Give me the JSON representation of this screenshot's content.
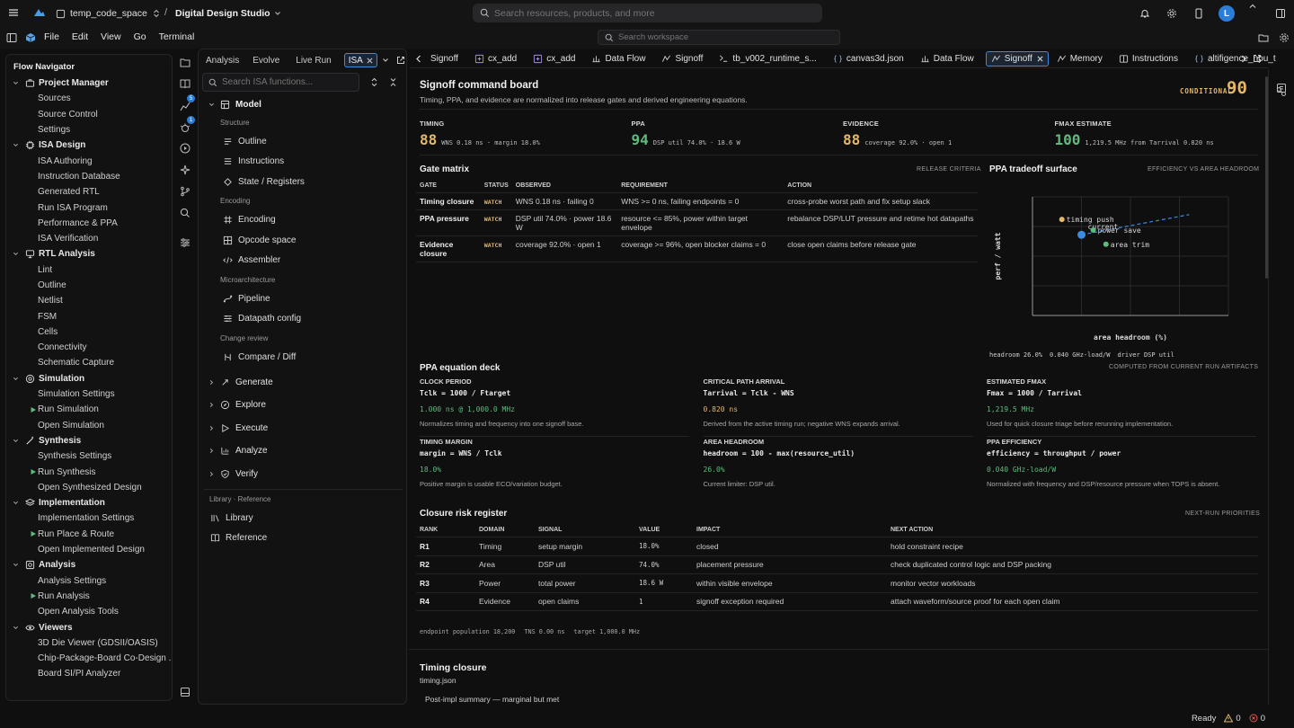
{
  "topbar": {
    "workspace": "temp_code_space",
    "separator": "/",
    "project": "Digital Design Studio",
    "search_placeholder": "Search resources, products, and more",
    "avatar_letter": "L"
  },
  "menubar": {
    "items": [
      "File",
      "Edit",
      "View",
      "Go",
      "Terminal"
    ],
    "workspace_search_placeholder": "Search workspace"
  },
  "activity": {
    "badge1": "5",
    "badge2": "1"
  },
  "navigator": {
    "title": "Flow Navigator",
    "groups": [
      {
        "label": "Project Manager",
        "items": [
          "Sources",
          "Source Control",
          "Settings"
        ]
      },
      {
        "label": "ISA Design",
        "items": [
          "ISA Authoring",
          "Instruction Database",
          "Generated RTL",
          "Run ISA Program",
          "Performance & PPA",
          "ISA Verification"
        ]
      },
      {
        "label": "RTL Analysis",
        "items": [
          "Lint",
          "Outline",
          "Netlist",
          "FSM",
          "Cells",
          "Connectivity",
          "Schematic Capture"
        ]
      },
      {
        "label": "Simulation",
        "items": [
          "Simulation Settings",
          "Run Simulation",
          "Open Simulation"
        ]
      },
      {
        "label": "Synthesis",
        "items": [
          "Synthesis Settings",
          "Run Synthesis",
          "Open Synthesized Design"
        ]
      },
      {
        "label": "Implementation",
        "items": [
          "Implementation Settings",
          "Run Place & Route",
          "Open Implemented Design"
        ]
      },
      {
        "label": "Analysis",
        "items": [
          "Analysis Settings",
          "Run Analysis",
          "Open Analysis Tools"
        ]
      },
      {
        "label": "Viewers",
        "items": [
          "3D Die Viewer (GDSII/OASIS)",
          "Chip-Package-Board Co-Design ...",
          "Board SI/PI Analyzer"
        ]
      }
    ]
  },
  "isa_panel": {
    "tabs": [
      "Analysis",
      "Evolve",
      "Live Run",
      "ISA"
    ],
    "search_placeholder": "Search ISA functions...",
    "model_label": "Model",
    "sections": [
      {
        "heading": "Structure",
        "items": [
          "Outline",
          "Instructions",
          "State / Registers"
        ]
      },
      {
        "heading": "Encoding",
        "items": [
          "Encoding",
          "Opcode space",
          "Assembler"
        ]
      },
      {
        "heading": "Microarchitecture",
        "items": [
          "Pipeline",
          "Datapath config"
        ]
      },
      {
        "heading": "Change review",
        "items": [
          "Compare / Diff"
        ]
      }
    ],
    "collapsed": [
      "Generate",
      "Explore",
      "Execute",
      "Analyze",
      "Verify"
    ],
    "library_heading": "Library · Reference",
    "library_items": [
      "Library",
      "Reference"
    ]
  },
  "editor_tabs": [
    "Signoff",
    "cx_add",
    "cx_add",
    "Data Flow",
    "Signoff",
    "tb_v002_runtime_s...",
    "canvas3d.json",
    "Data Flow",
    "Signoff",
    "Memory",
    "Instructions",
    "altifigence_npu_t"
  ],
  "board": {
    "title": "Signoff command board",
    "subtitle": "Timing, PPA, and evidence are normalized into release gates and derived engineering equations.",
    "status": "CONDITIONAL",
    "score": "90",
    "metrics": [
      {
        "label": "TIMING",
        "value": "88",
        "detail": "WNS 0.18 ns · margin 18.0%",
        "color": "yellow"
      },
      {
        "label": "PPA",
        "value": "94",
        "detail": "DSP util 74.0% · 18.6 W",
        "color": "green"
      },
      {
        "label": "EVIDENCE",
        "value": "88",
        "detail": "coverage 92.0% · open 1",
        "color": "yellow"
      },
      {
        "label": "FMAX ESTIMATE",
        "value": "100",
        "detail": "1,219.5 MHz from Tarrival 0.820 ns",
        "color": "green"
      }
    ],
    "gate_matrix": {
      "title": "Gate matrix",
      "caption": "RELEASE CRITERIA",
      "headers": [
        "GATE",
        "STATUS",
        "OBSERVED",
        "REQUIREMENT",
        "ACTION"
      ],
      "rows": [
        {
          "gate": "Timing closure",
          "status": "WATCH",
          "observed": "WNS 0.18 ns · failing 0",
          "requirement": "WNS >= 0 ns, failing endpoints = 0",
          "action": "cross-probe worst path and fix setup slack"
        },
        {
          "gate": "PPA pressure",
          "status": "WATCH",
          "observed": "DSP util 74.0% · power 18.6 W",
          "requirement": "resource <= 85%, power within target envelope",
          "action": "rebalance DSP/LUT pressure and retime hot datapaths"
        },
        {
          "gate": "Evidence closure",
          "status": "WATCH",
          "observed": "coverage 92.0% · open 1",
          "requirement": "coverage >= 96%, open blocker claims = 0",
          "action": "close open claims before release gate"
        }
      ]
    },
    "tradeoff": {
      "title": "PPA tradeoff surface",
      "caption": "EFFICIENCY VS AREA HEADROOM",
      "footer": "COMPUTED FROM CURRENT RUN ARTIFACTS",
      "readouts": [
        "headroom 26.0%",
        "0.040 GHz-load/W",
        "driver DSP util"
      ]
    },
    "equations": {
      "title": "PPA equation deck",
      "items": [
        {
          "title": "CLOCK PERIOD",
          "formula": "Tclk = 1000 / Ftarget",
          "value": "1.000 ns @ 1,000.0 MHz",
          "note": "Normalizes timing and frequency into one signoff base.",
          "color": "green"
        },
        {
          "title": "CRITICAL PATH ARRIVAL",
          "formula": "Tarrival = Tclk - WNS",
          "value": "0.820 ns",
          "note": "Derived from the active timing run; negative WNS expands arrival.",
          "color": "yellow"
        },
        {
          "title": "ESTIMATED FMAX",
          "formula": "Fmax = 1000 / Tarrival",
          "value": "1,219.5 MHz",
          "note": "Used for quick closure triage before rerunning implementation.",
          "color": "green"
        },
        {
          "title": "TIMING MARGIN",
          "formula": "margin = WNS / Tclk",
          "value": "18.0%",
          "note": "Positive margin is usable ECO/variation budget.",
          "color": "green"
        },
        {
          "title": "AREA HEADROOM",
          "formula": "headroom = 100 - max(resource_util)",
          "value": "26.0%",
          "note": "Current limiter: DSP util.",
          "color": "green"
        },
        {
          "title": "PPA EFFICIENCY",
          "formula": "efficiency = throughput / power",
          "value": "0.040 GHz-load/W",
          "note": "Normalized with frequency and DSP/resource pressure when TOPS is absent.",
          "color": "green"
        }
      ]
    },
    "risk": {
      "title": "Closure risk register",
      "caption": "NEXT-RUN PRIORITIES",
      "headers": [
        "RANK",
        "DOMAIN",
        "SIGNAL",
        "VALUE",
        "IMPACT",
        "NEXT ACTION"
      ],
      "rows": [
        {
          "rank": "R1",
          "domain": "Timing",
          "signal": "setup margin",
          "value": "18.0%",
          "impact": "closed",
          "next": "hold constraint recipe"
        },
        {
          "rank": "R2",
          "domain": "Area",
          "signal": "DSP util",
          "value": "74.0%",
          "impact": "placement pressure",
          "next": "check duplicated control logic and DSP packing"
        },
        {
          "rank": "R3",
          "domain": "Power",
          "signal": "total power",
          "value": "18.6 W",
          "impact": "within visible envelope",
          "next": "monitor vector workloads"
        },
        {
          "rank": "R4",
          "domain": "Evidence",
          "signal": "open claims",
          "value": "1",
          "impact": "signoff exception required",
          "next": "attach waveform/source proof for each open claim"
        }
      ],
      "footer": [
        "endpoint population 18,200",
        "TNS 0.00 ns",
        "target 1,000.0 MHz"
      ]
    },
    "timing_closure": {
      "title": "Timing closure",
      "file": "timing.json",
      "summary": "Post-impl summary — marginal but met"
    }
  },
  "chart_data": {
    "type": "scatter",
    "title": "PPA tradeoff surface",
    "xlabel": "area headroom (%)",
    "ylabel": "perf / watt",
    "points": [
      {
        "label": "timing push",
        "x": 0.3,
        "y": 0.81,
        "color": "#e5b867"
      },
      {
        "label": "current",
        "x": 0.5,
        "y": 0.68,
        "color": "#3b8ce0"
      },
      {
        "label": "power save",
        "x": 0.62,
        "y": 0.72,
        "color": "#5fba7d"
      },
      {
        "label": "area trim",
        "x": 0.75,
        "y": 0.6,
        "color": "#5fba7d"
      }
    ],
    "trend": {
      "from": [
        0.5,
        0.68
      ],
      "to": [
        1.6,
        0.85
      ]
    },
    "grid": true
  },
  "statusbar": {
    "status": "Ready",
    "warnings": "0",
    "errors": "0"
  },
  "colors": {
    "accent": "#3b8ce0",
    "yellow": "#e5b867",
    "green": "#5fba7d"
  }
}
